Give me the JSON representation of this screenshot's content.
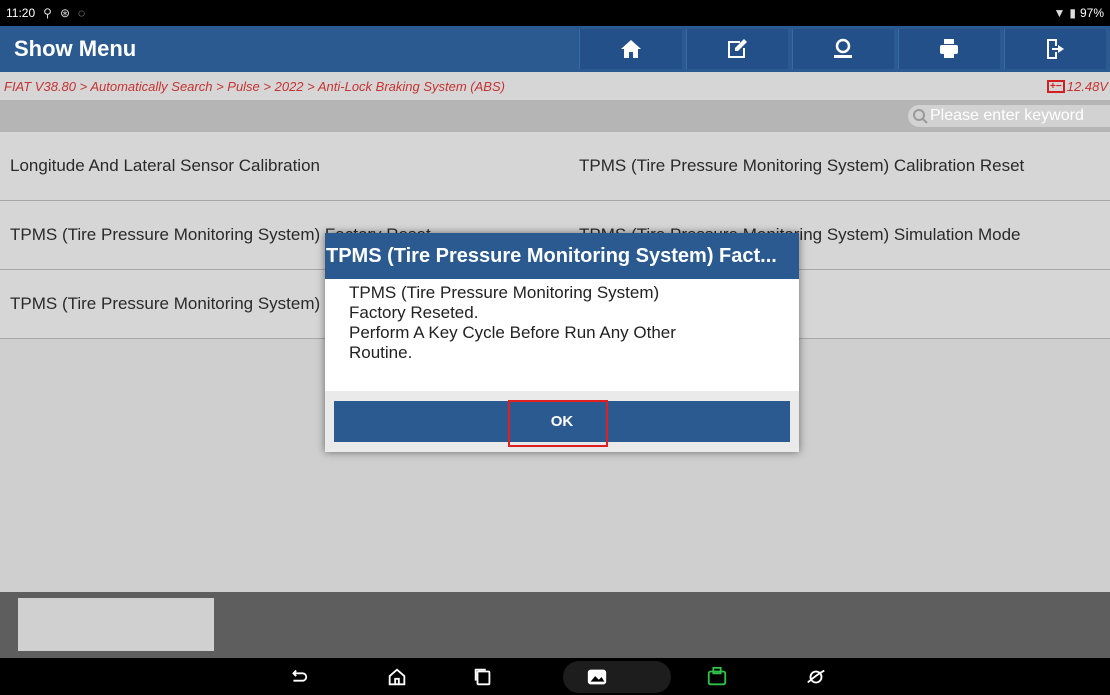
{
  "status": {
    "time": "11:20",
    "battery": "97%"
  },
  "header": {
    "title": "Show Menu",
    "buttons": [
      "home-icon",
      "report-icon",
      "user-icon",
      "print-icon",
      "exit-icon"
    ]
  },
  "breadcrumb": {
    "path": "FIAT V38.80 > Automatically Search > Pulse > 2022 > Anti-Lock Braking System (ABS)",
    "voltage": "12.48V"
  },
  "search": {
    "placeholder": "Please enter keyword"
  },
  "menu": {
    "items": [
      "Longitude And Lateral Sensor Calibration",
      "TPMS (Tire Pressure Monitoring System) Calibration Reset",
      "TPMS (Tire Pressure Monitoring System) Factory Reset",
      "TPMS (Tire Pressure Monitoring System) Simulation Mode",
      "TPMS (Tire Pressure Monitoring System) Tire Pressure"
    ]
  },
  "dialog": {
    "title": "TPMS (Tire Pressure Monitoring System) Fact...",
    "line1": "TPMS (Tire Pressure Monitoring System)",
    "line2": "Factory Reseted.",
    "line3": "Perform A Key Cycle Before Run Any Other",
    "line4": "Routine.",
    "ok_label": "OK"
  },
  "colors": {
    "header": "#2b5a91",
    "breadcrumb_text": "#c83232",
    "highlight": "#e02020"
  }
}
